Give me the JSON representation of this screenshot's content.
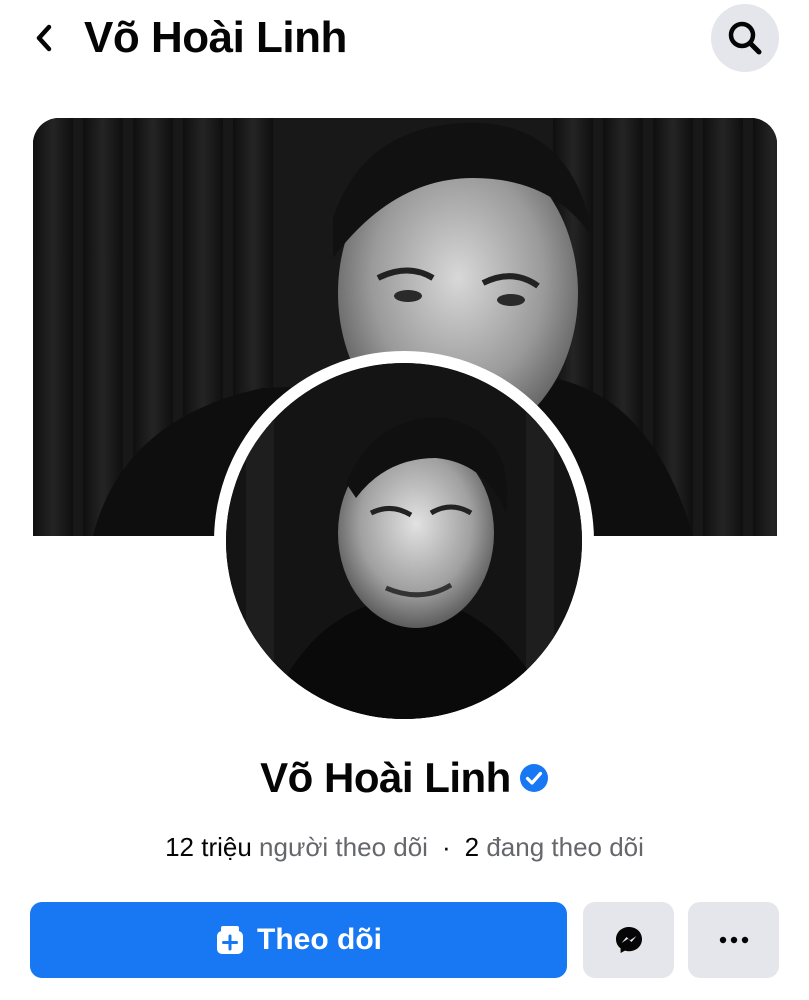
{
  "header": {
    "back_icon": "chevron-left-icon",
    "title": "Võ Hoài Linh",
    "search_icon": "search-icon"
  },
  "profile": {
    "cover_image": "cover-photo",
    "avatar_image": "profile-photo",
    "name": "Võ Hoài Linh",
    "verified_icon": "verified-badge-icon"
  },
  "stats": {
    "followers_count": "12 triệu",
    "followers_label": "người theo dõi",
    "separator": "·",
    "following_count": "2",
    "following_label": "đang theo dõi"
  },
  "actions": {
    "follow_label": "Theo dõi",
    "follow_icon": "follow-plus-icon",
    "messenger_icon": "messenger-icon",
    "more_icon": "more-dots-icon"
  },
  "colors": {
    "accent": "#1877f2",
    "secondary_button": "#e4e6eb",
    "text": "#050505",
    "muted_text": "#65676b"
  }
}
